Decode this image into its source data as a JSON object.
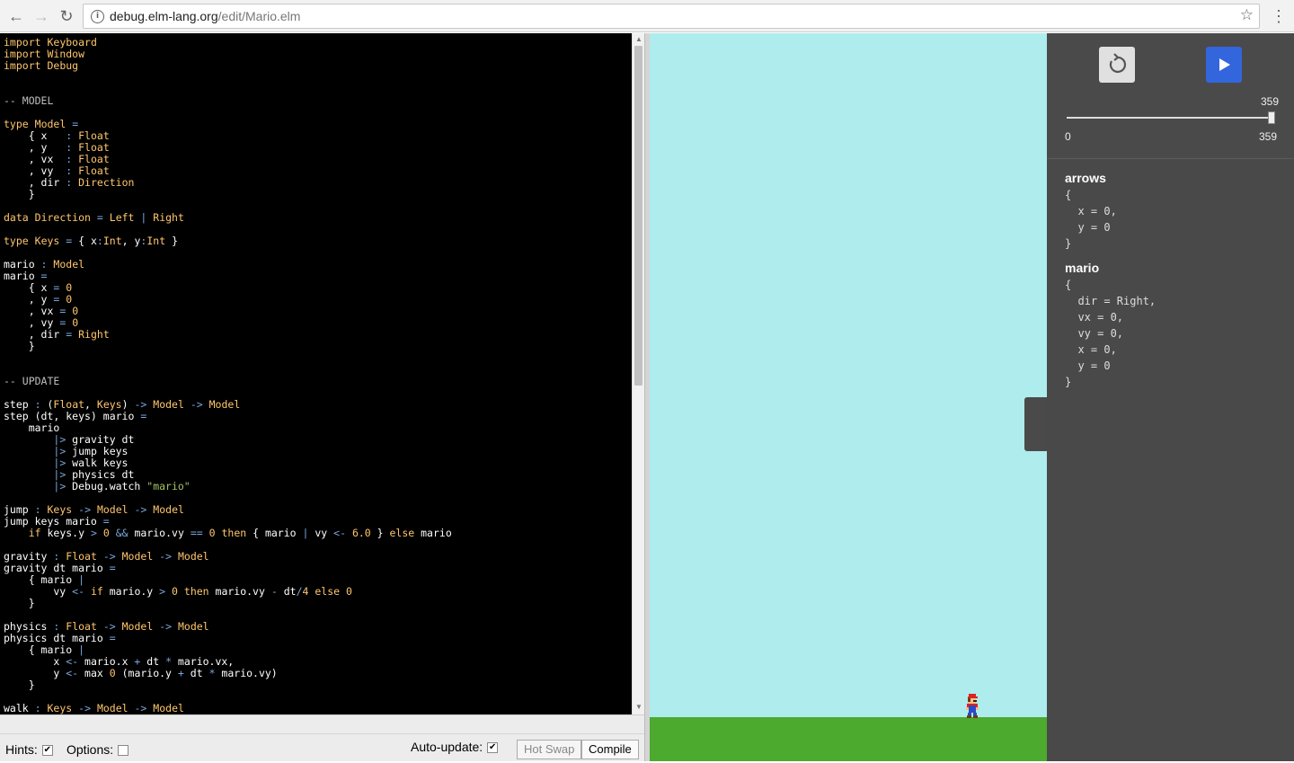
{
  "browser": {
    "url_host": "debug.elm-lang.org",
    "url_path": "/edit/Mario.elm",
    "back_icon": "arrow-left-icon",
    "forward_icon": "arrow-right-icon",
    "reload_icon": "reload-icon"
  },
  "editor": {
    "code_lines": [
      "import Keyboard",
      "import Window",
      "import Debug",
      "",
      "",
      "-- MODEL",
      "",
      "type Model =",
      "    { x   : Float",
      "    , y   : Float",
      "    , vx  : Float",
      "    , vy  : Float",
      "    , dir : Direction",
      "    }",
      "",
      "data Direction = Left | Right",
      "",
      "type Keys = { x:Int, y:Int }",
      "",
      "mario : Model",
      "mario =",
      "    { x = 0",
      "    , y = 0",
      "    , vx = 0",
      "    , vy = 0",
      "    , dir = Right",
      "    }",
      "",
      "",
      "-- UPDATE",
      "",
      "step : (Float, Keys) -> Model -> Model",
      "step (dt, keys) mario =",
      "    mario",
      "        |> gravity dt",
      "        |> jump keys",
      "        |> walk keys",
      "        |> physics dt",
      "        |> Debug.watch \"mario\"",
      "",
      "jump : Keys -> Model -> Model",
      "jump keys mario =",
      "    if keys.y > 0 && mario.vy == 0 then { mario | vy <- 6.0 } else mario",
      "",
      "gravity : Float -> Model -> Model",
      "gravity dt mario =",
      "    { mario |",
      "        vy <- if mario.y > 0 then mario.vy - dt/4 else 0",
      "    }",
      "",
      "physics : Float -> Model -> Model",
      "physics dt mario =",
      "    { mario |",
      "        x <- mario.x + dt * mario.vx,",
      "        y <- max 0 (mario.y + dt * mario.vy)",
      "    }",
      "",
      "walk : Keys -> Model -> Model"
    ]
  },
  "bottombar": {
    "hints_label": "Hints:",
    "hints_checked": true,
    "options_label": "Options:",
    "options_checked": false,
    "autoupdate_label": "Auto-update:",
    "autoupdate_checked": true,
    "hotswap_label": "Hot Swap",
    "compile_label": "Compile"
  },
  "debugger": {
    "restart_icon": "restart-icon",
    "play_icon": "play-icon",
    "current_step": "359",
    "min_step": "0",
    "max_step": "359",
    "slider_fraction": 1.0,
    "watches": [
      {
        "name": "arrows",
        "value": "{\n  x = 0,\n  y = 0\n}"
      },
      {
        "name": "mario",
        "value": "{\n  dir = Right,\n  vx = 0,\n  vy = 0,\n  x = 0,\n  y = 0\n}"
      }
    ]
  },
  "colors": {
    "sky": "#aeeced",
    "ground": "#4caa2f",
    "play_button": "#3366dd",
    "debugger_bg": "#494949"
  }
}
